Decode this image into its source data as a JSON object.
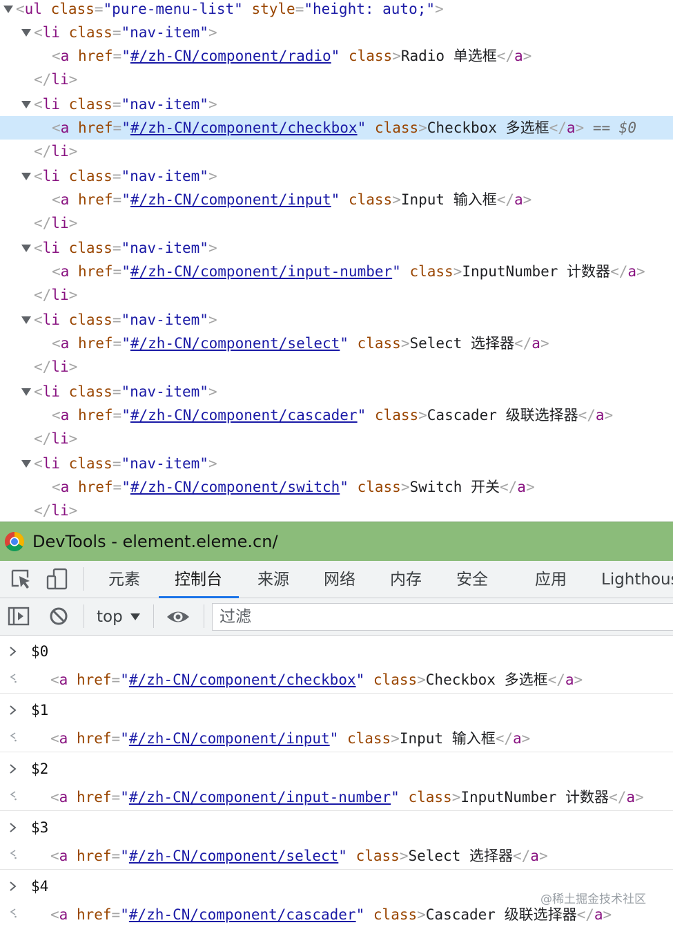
{
  "elements": {
    "ul": {
      "tag": "ul",
      "attr1": "class",
      "val1": "pure-menu-list",
      "attr2": "style",
      "val2": "height: auto;"
    },
    "li_tag": "li",
    "li_attr": "class",
    "li_val": "nav-item",
    "a_tag": "a",
    "href_attr": "href",
    "class_attr": "class",
    "selected_marker": "== $0",
    "items": [
      {
        "href": "#/zh-CN/component/radio",
        "text": "Radio 单选框"
      },
      {
        "href": "#/zh-CN/component/checkbox",
        "text": "Checkbox 多选框"
      },
      {
        "href": "#/zh-CN/component/input",
        "text": "Input 输入框"
      },
      {
        "href": "#/zh-CN/component/input-number",
        "text": "InputNumber 计数器"
      },
      {
        "href": "#/zh-CN/component/select",
        "text": "Select 选择器"
      },
      {
        "href": "#/zh-CN/component/cascader",
        "text": "Cascader 级联选择器"
      },
      {
        "href": "#/zh-CN/component/switch",
        "text": "Switch 开关"
      }
    ]
  },
  "titlebar": {
    "title": "DevTools - element.eleme.cn/"
  },
  "tabs": {
    "items": [
      "元素",
      "控制台",
      "来源",
      "网络",
      "内存",
      "安全",
      "应用",
      "Lighthouse"
    ],
    "active": "控制台"
  },
  "console_toolbar": {
    "context": "top",
    "filter_placeholder": "过滤",
    "icons": [
      "sidebar-toggle-icon",
      "clear-console-icon",
      "eye-icon"
    ]
  },
  "console": {
    "messages": [
      {
        "cmd": "$0",
        "href": "#/zh-CN/component/checkbox",
        "text": "Checkbox 多选框"
      },
      {
        "cmd": "$1",
        "href": "#/zh-CN/component/input",
        "text": "Input 输入框"
      },
      {
        "cmd": "$2",
        "href": "#/zh-CN/component/input-number",
        "text": "InputNumber 计数器"
      },
      {
        "cmd": "$3",
        "href": "#/zh-CN/component/select",
        "text": "Select 选择器"
      },
      {
        "cmd": "$4",
        "href": "#/zh-CN/component/cascader",
        "text": "Cascader 级联选择器"
      }
    ]
  },
  "watermark": "@稀土掘金技术社区"
}
